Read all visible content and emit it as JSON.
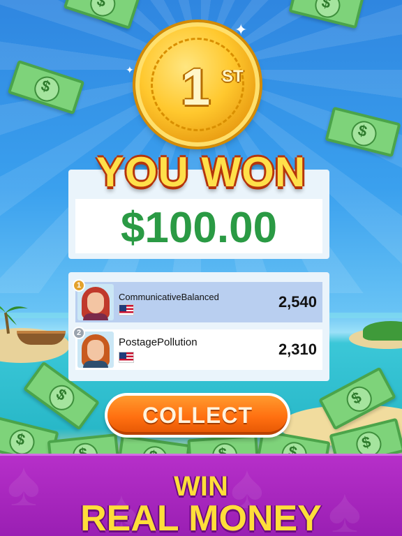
{
  "coin": {
    "rank": "1",
    "suffix": "ST"
  },
  "result": {
    "title": "YOU WON",
    "prize": "$100.00"
  },
  "leaderboard": [
    {
      "rank": "1",
      "name": "CommunicativeBalanced",
      "country": "us-flag-icon",
      "score": "2,540",
      "badge_color": "#e3a22c"
    },
    {
      "rank": "2",
      "name": "PostagePollution",
      "country": "us-flag-icon",
      "score": "2,310",
      "badge_color": "#9aa3ad"
    }
  ],
  "collect_button": {
    "label": "COLLECT"
  },
  "banner": {
    "line1": "WIN",
    "line2": "REAL MONEY"
  },
  "colors": {
    "prize_green": "#2a9a44",
    "title_yellow": "#ffe04a",
    "button_orange": "#ff6f10",
    "banner_purple": "#a523bd"
  }
}
